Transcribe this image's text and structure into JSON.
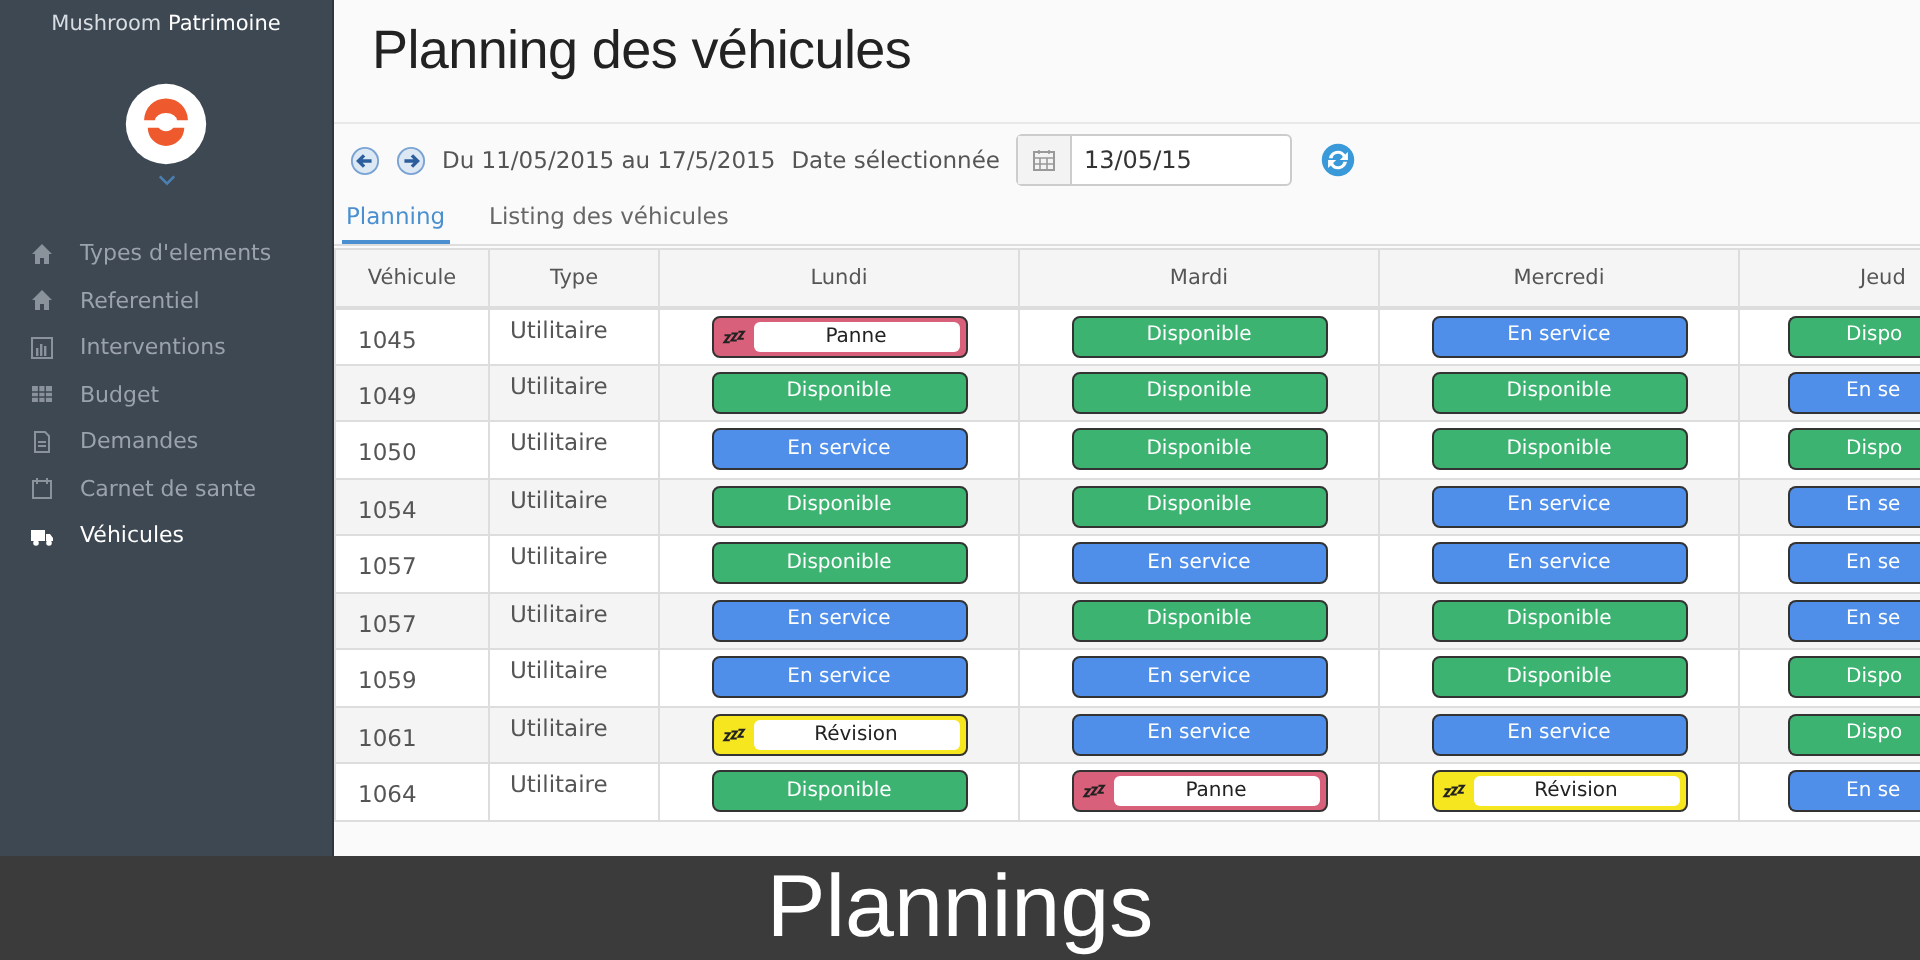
{
  "sidebar": {
    "brand_light": "Mushroom",
    "brand_bold": "Patrimoine",
    "items": [
      {
        "label": "Types d'elements",
        "kind": "home",
        "selected": false
      },
      {
        "label": "Referentiel",
        "kind": "home",
        "selected": false
      },
      {
        "label": "Interventions",
        "kind": "chart",
        "selected": false
      },
      {
        "label": "Budget",
        "kind": "table",
        "selected": false
      },
      {
        "label": "Demandes",
        "kind": "file",
        "selected": false
      },
      {
        "label": "Carnet de sante",
        "kind": "calendar",
        "selected": false
      },
      {
        "label": "Véhicules",
        "kind": "truck",
        "selected": true
      }
    ]
  },
  "page_title": "Planning des véhicules",
  "toolbar": {
    "range": "Du 11/05/2015 au 17/5/2015",
    "date_label": "Date sélectionnée",
    "date_value": "13/05/15"
  },
  "tabs": [
    {
      "label": "Planning",
      "selected": true
    },
    {
      "label": "Listing des véhicules",
      "selected": false
    }
  ],
  "table": {
    "columns": [
      "Véhicule",
      "Type",
      "Lundi",
      "Mardi",
      "Mercredi",
      "Jeud"
    ],
    "rows": [
      {
        "vehicle": "1045",
        "type": "Utilitaire",
        "days": [
          {
            "kind": "panne",
            "label": "Panne"
          },
          {
            "kind": "disponible",
            "label": "Disponible"
          },
          {
            "kind": "en_service",
            "label": "En service"
          },
          {
            "kind": "disponible",
            "label": "Dispo"
          }
        ]
      },
      {
        "vehicle": "1049",
        "type": "Utilitaire",
        "days": [
          {
            "kind": "disponible",
            "label": "Disponible"
          },
          {
            "kind": "disponible",
            "label": "Disponible"
          },
          {
            "kind": "disponible",
            "label": "Disponible"
          },
          {
            "kind": "en_service",
            "label": "En se"
          }
        ]
      },
      {
        "vehicle": "1050",
        "type": "Utilitaire",
        "days": [
          {
            "kind": "en_service",
            "label": "En service"
          },
          {
            "kind": "disponible",
            "label": "Disponible"
          },
          {
            "kind": "disponible",
            "label": "Disponible"
          },
          {
            "kind": "disponible",
            "label": "Dispo"
          }
        ]
      },
      {
        "vehicle": "1054",
        "type": "Utilitaire",
        "days": [
          {
            "kind": "disponible",
            "label": "Disponible"
          },
          {
            "kind": "disponible",
            "label": "Disponible"
          },
          {
            "kind": "en_service",
            "label": "En service"
          },
          {
            "kind": "en_service",
            "label": "En se"
          }
        ]
      },
      {
        "vehicle": "1057",
        "type": "Utilitaire",
        "days": [
          {
            "kind": "disponible",
            "label": "Disponible"
          },
          {
            "kind": "en_service",
            "label": "En service"
          },
          {
            "kind": "en_service",
            "label": "En service"
          },
          {
            "kind": "en_service",
            "label": "En se"
          }
        ]
      },
      {
        "vehicle": "1057",
        "type": "Utilitaire",
        "days": [
          {
            "kind": "en_service",
            "label": "En service"
          },
          {
            "kind": "disponible",
            "label": "Disponible"
          },
          {
            "kind": "disponible",
            "label": "Disponible"
          },
          {
            "kind": "en_service",
            "label": "En se"
          }
        ]
      },
      {
        "vehicle": "1059",
        "type": "Utilitaire",
        "days": [
          {
            "kind": "en_service",
            "label": "En service"
          },
          {
            "kind": "en_service",
            "label": "En service"
          },
          {
            "kind": "disponible",
            "label": "Disponible"
          },
          {
            "kind": "disponible",
            "label": "Dispo"
          }
        ]
      },
      {
        "vehicle": "1061",
        "type": "Utilitaire",
        "days": [
          {
            "kind": "revision",
            "label": "Révision"
          },
          {
            "kind": "en_service",
            "label": "En service"
          },
          {
            "kind": "en_service",
            "label": "En service"
          },
          {
            "kind": "disponible",
            "label": "Dispo"
          }
        ]
      },
      {
        "vehicle": "1064",
        "type": "Utilitaire",
        "days": [
          {
            "kind": "disponible",
            "label": "Disponible"
          },
          {
            "kind": "panne",
            "label": "Panne"
          },
          {
            "kind": "revision",
            "label": "Révision"
          },
          {
            "kind": "en_service",
            "label": "En se"
          }
        ]
      }
    ]
  },
  "caption": "Plannings"
}
